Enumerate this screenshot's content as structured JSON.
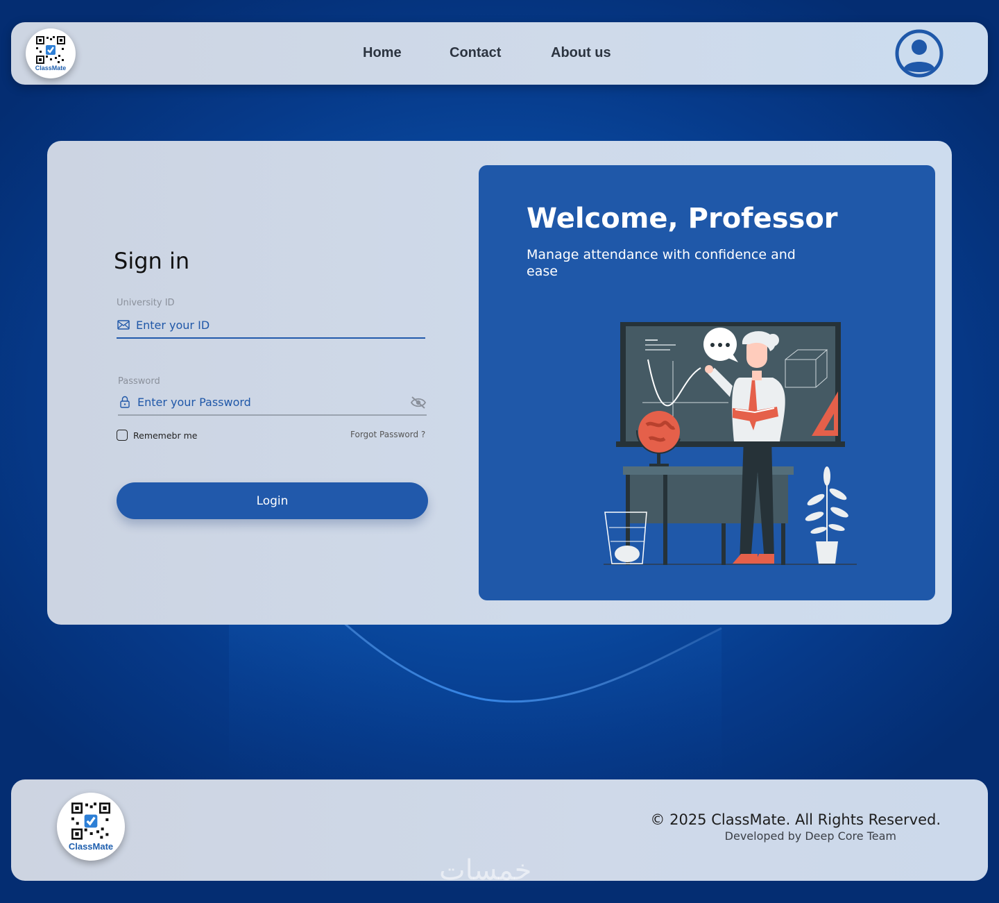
{
  "header": {
    "logo_text": "ClassMate",
    "nav": [
      {
        "label": "Home"
      },
      {
        "label": "Contact"
      },
      {
        "label": "About us"
      }
    ]
  },
  "signin": {
    "title": "Sign in",
    "university_id": {
      "label": "University ID",
      "placeholder": "Enter your ID",
      "value": ""
    },
    "password": {
      "label": "Password",
      "placeholder": "Enter your Password",
      "value": ""
    },
    "remember_label": "Rememebr me",
    "remember_checked": false,
    "forgot_label": "Forgot Password ?",
    "login_label": "Login"
  },
  "welcome": {
    "title": "Welcome, Professor",
    "subtitle": "Manage attendance with confidence and ease"
  },
  "footer": {
    "logo_text": "ClassMate",
    "copyright": "© 2025 ClassMate. All Rights Reserved.",
    "developed": "Developed by Deep Core Team",
    "watermark": "خمسات"
  },
  "icons": {
    "email": "envelope-icon",
    "password": "lock-icon",
    "visibility": "eye-off-icon",
    "profile": "user-circle-icon"
  },
  "colors": {
    "primary": "#2159ab",
    "accent_red": "#e5604a",
    "background": "#0b4fa8"
  }
}
